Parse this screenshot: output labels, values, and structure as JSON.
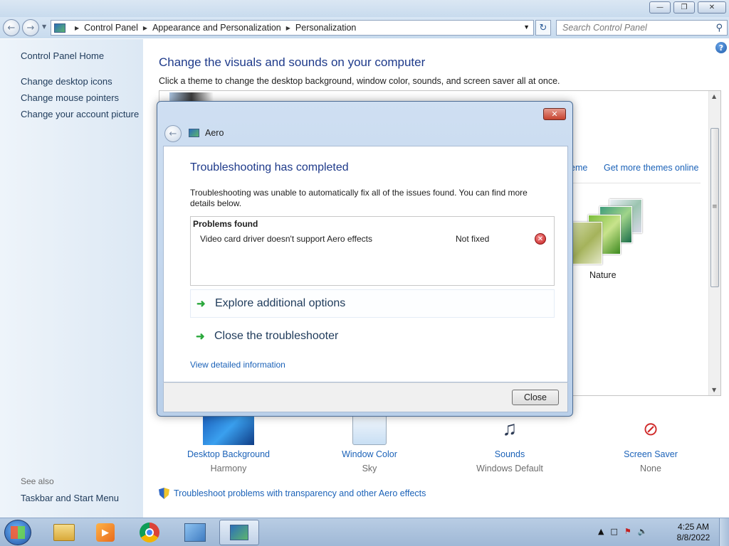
{
  "window": {
    "buttons": {
      "minimize": "—",
      "maximize": "❐",
      "close": "✕"
    }
  },
  "addressbar": {
    "breadcrumbs": [
      "Control Panel",
      "Appearance and Personalization",
      "Personalization"
    ],
    "search_placeholder": "Search Control Panel"
  },
  "sidebar": {
    "home": "Control Panel Home",
    "links": [
      "Change desktop icons",
      "Change mouse pointers",
      "Change your account picture"
    ],
    "see_also_label": "See also",
    "see_also_links": [
      "Taskbar and Start Menu"
    ]
  },
  "main": {
    "title": "Change the visuals and sounds on your computer",
    "subtitle": "Click a theme to change the desktop background, window color, sounds, and screen saver all at once.",
    "theme_links": {
      "partial": "eme",
      "get_more": "Get more themes online"
    },
    "theme_name": "Nature",
    "bottom_items": [
      {
        "label": "Desktop Background",
        "value": "Harmony",
        "icon": "desktop-background-icon"
      },
      {
        "label": "Window Color",
        "value": "Sky",
        "icon": "window-color-icon"
      },
      {
        "label": "Sounds",
        "value": "Windows Default",
        "icon": "sounds-icon"
      },
      {
        "label": "Screen Saver",
        "value": "None",
        "icon": "screen-saver-icon"
      }
    ],
    "troubleshoot_link": "Troubleshoot problems with transparency and other Aero effects"
  },
  "dialog": {
    "title": "Aero",
    "heading": "Troubleshooting has completed",
    "text": "Troubleshooting was unable to automatically fix all of the issues found. You can find more details below.",
    "problems_header": "Problems found",
    "problem": {
      "description": "Video card driver doesn't support Aero effects",
      "status": "Not fixed"
    },
    "options": [
      "Explore additional options",
      "Close the troubleshooter"
    ],
    "view_details": "View detailed information",
    "close_button": "Close"
  },
  "taskbar": {
    "time": "4:25 AM",
    "date": "8/8/2022",
    "apps": [
      "file-explorer-icon",
      "media-player-icon",
      "chrome-icon",
      "control-panel-icon",
      "aero-troubleshooter-icon"
    ]
  },
  "colors": {
    "link": "#1b62b8",
    "heading": "#1e3a8a",
    "titlebar": "#c8dbee",
    "taskbar": "#9fb8d6"
  }
}
